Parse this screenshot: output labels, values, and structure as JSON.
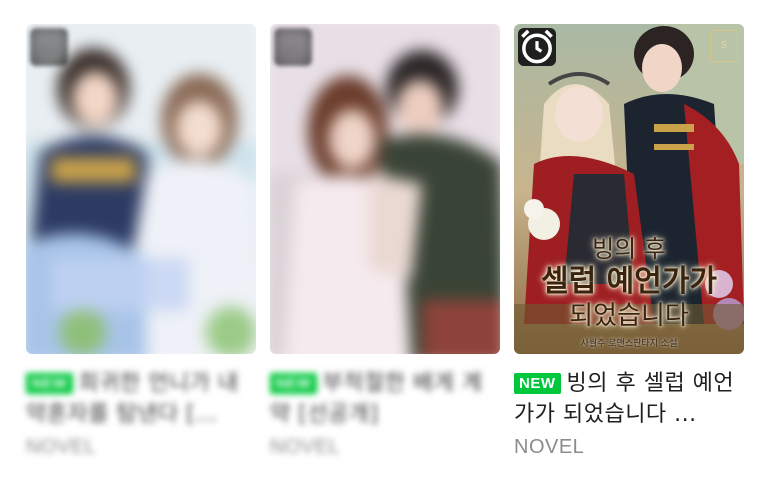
{
  "cards": [
    {
      "badge": "NEW",
      "title": "희귀한 언니가 내 약혼자를 탐낸다 [...",
      "category": "NOVEL",
      "alarm_icon": "alarm-clock-icon",
      "blurred": true
    },
    {
      "badge": "NEW",
      "title": "부적절한 배게 계약 [선공개]",
      "category": "NOVEL",
      "alarm_icon": "alarm-clock-icon",
      "blurred": true
    },
    {
      "badge": "NEW",
      "title": "빙의 후 셀럽 예언가가 되었습니다 ...",
      "category": "NOVEL",
      "alarm_icon": "alarm-clock-icon",
      "blurred": false,
      "cover_text": {
        "line1": "빙의 후",
        "line2": "셀럽 예언가가",
        "line3": "되었습니다",
        "author": "사월주 로맨스판타지 소설",
        "logo": "S"
      }
    }
  ],
  "colors": {
    "new_badge": "#00c73c",
    "category_text": "#8c8c8c",
    "title_text": "#202020",
    "alarm_badge_bg": "#1f1f1f"
  }
}
